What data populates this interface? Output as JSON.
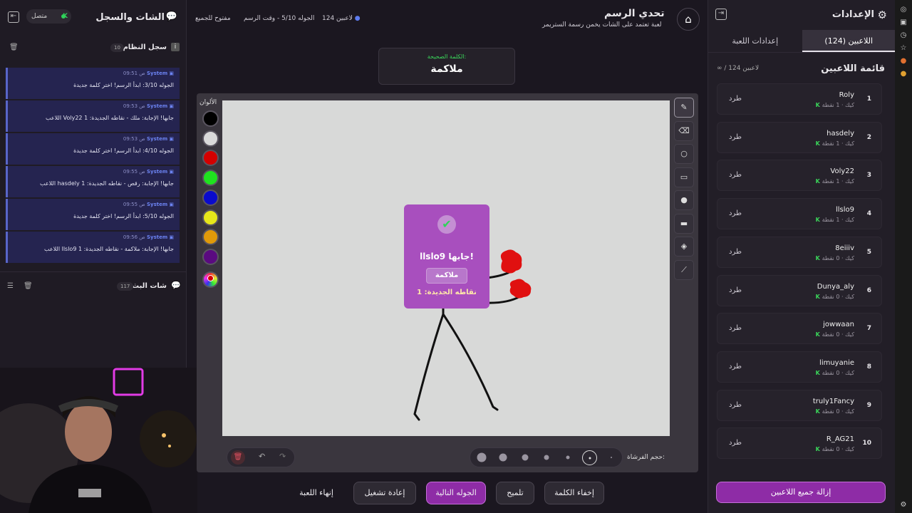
{
  "header": {
    "title": "تحدي الرسم",
    "subtitle": "لعبة تعتمد على الشات يخمن رسمة الستريمر",
    "players_count": "124 لاعبين",
    "round_info": "الجوله 5/10 - وقت الرسم",
    "mode": "مفتوح للجميع"
  },
  "correct_word": {
    "label": "الكلمة الصحيحة:",
    "word": "ملاكمة"
  },
  "settings_panel": {
    "title": "الإعدادات",
    "tabs": [
      {
        "label": "اللاعبين (124)",
        "active": true
      },
      {
        "label": "إعدادات اللعبة",
        "active": false
      }
    ],
    "list_title": "قائمة اللاعبين",
    "list_count": "∞ / 124 لاعبين",
    "kick_label": "طرد",
    "remove_all_label": "إزالة جميع اللاعبين",
    "players": [
      {
        "index": "1",
        "name": "Roly",
        "meta": "كيك · 1 نقطة"
      },
      {
        "index": "2",
        "name": "hasdely",
        "meta": "كيك · 1 نقطة"
      },
      {
        "index": "3",
        "name": "Voly22",
        "meta": "كيك · 1 نقطة"
      },
      {
        "index": "4",
        "name": "llslo9",
        "meta": "كيك · 1 نقطة"
      },
      {
        "index": "5",
        "name": "8eiiiv",
        "meta": "كيك · 0 نقطة"
      },
      {
        "index": "6",
        "name": "Dunya_aly",
        "meta": "كيك · 0 نقطة"
      },
      {
        "index": "7",
        "name": "jowwaan",
        "meta": "كيك · 0 نقطة"
      },
      {
        "index": "8",
        "name": "limuyanie",
        "meta": "كيك · 0 نقطة"
      },
      {
        "index": "9",
        "name": "truly1Fancy",
        "meta": "كيك · 0 نقطة"
      },
      {
        "index": "10",
        "name": "R_AG21",
        "meta": "كيك · 0 نقطة"
      }
    ]
  },
  "chat_panel": {
    "title": "الشات والسجل",
    "status": "متصل",
    "system_log": {
      "title": "سجل النظام",
      "count": "10",
      "messages": [
        {
          "sender": "System",
          "time": "09:51 ص",
          "text": "الجوله 3/10: ابدأ الرسم! اختر كلمة جديدة"
        },
        {
          "sender": "System",
          "time": "09:53 ص",
          "text": "اللاعب Voly22 جابها! الإجابة: ملك - نقاطه الجديدة: 1"
        },
        {
          "sender": "System",
          "time": "09:53 ص",
          "text": "الجوله 4/10: ابدأ الرسم! اختر كلمة جديدة"
        },
        {
          "sender": "System",
          "time": "09:55 ص",
          "text": "اللاعب hasdely جابها! الإجابة: رقص - نقاطه الجديدة: 1"
        },
        {
          "sender": "System",
          "time": "09:55 ص",
          "text": "الجوله 5/10: ابدأ الرسم! اختر كلمة جديدة"
        },
        {
          "sender": "System",
          "time": "09:56 ص",
          "text": "اللاعب llslo9 جابها! الإجابة: ملاكمة - نقاطه الجديدة: 1"
        }
      ]
    },
    "stream_chat": {
      "title": "شات البث",
      "count": "117"
    }
  },
  "board": {
    "colors_label": "الألوان",
    "colors": [
      "#000000",
      "#d9d9d9",
      "#d40000",
      "#1fe31f",
      "#0a0acc",
      "#e6e61a",
      "#e09a0a",
      "#5a0a80"
    ],
    "brush_label": "حجم الفرشاة:",
    "success": {
      "headline": "llslo9 جابها!",
      "word": "ملاكمة",
      "points": "نقاطه الجديدة: 1"
    }
  },
  "actions": {
    "hide_word": "إخفاء الكلمة",
    "hint": "تلميح",
    "next_round": "الجوله التالية",
    "restart": "إعادة تشغيل",
    "end_game": "إنهاء اللعبة"
  }
}
